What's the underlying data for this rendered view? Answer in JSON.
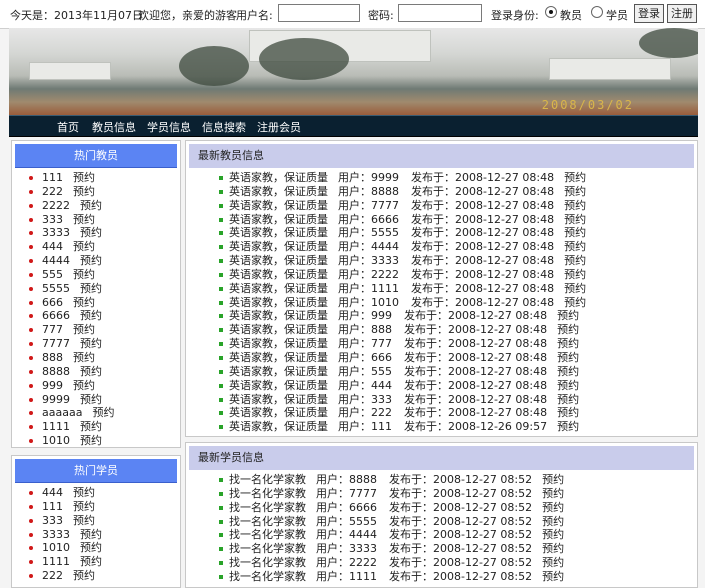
{
  "topbar": {
    "date_text": "今天是：2013年11月07日",
    "welcome": "欢迎您，亲爱的游客",
    "username_label": "用户名:",
    "username_value": "",
    "password_label": "密码:",
    "password_value": "",
    "role_label": "登录身份:",
    "role_teacher": "教员",
    "role_student": "学员",
    "role_selected": "教员",
    "login_button": "登录",
    "register_button": "注册"
  },
  "banner": {
    "date_overlay": "2008/03/02"
  },
  "nav": [
    "首页",
    "教员信息",
    "学员信息",
    "信息搜索",
    "注册会员"
  ],
  "hot_teachers": {
    "title": "热门教员",
    "book_label": "预约",
    "items": [
      "111",
      "222",
      "2222",
      "333",
      "3333",
      "444",
      "4444",
      "555",
      "5555",
      "666",
      "6666",
      "777",
      "7777",
      "888",
      "8888",
      "999",
      "9999",
      "aaaaaa",
      "1111",
      "1010"
    ]
  },
  "hot_students": {
    "title": "热门学员",
    "book_label": "预约",
    "items": [
      "444",
      "111",
      "333",
      "3333",
      "1010",
      "1111",
      "222"
    ]
  },
  "teacher_info": {
    "title": "最新教员信息",
    "user_label": "用户：",
    "published_label": "发布于：",
    "book_label": "预约",
    "rows": [
      {
        "title": "英语家教，保证质量",
        "user": "9999",
        "date": "2008-12-27 08:48"
      },
      {
        "title": "英语家教，保证质量",
        "user": "8888",
        "date": "2008-12-27 08:48"
      },
      {
        "title": "英语家教，保证质量",
        "user": "7777",
        "date": "2008-12-27 08:48"
      },
      {
        "title": "英语家教，保证质量",
        "user": "6666",
        "date": "2008-12-27 08:48"
      },
      {
        "title": "英语家教，保证质量",
        "user": "5555",
        "date": "2008-12-27 08:48"
      },
      {
        "title": "英语家教，保证质量",
        "user": "4444",
        "date": "2008-12-27 08:48"
      },
      {
        "title": "英语家教，保证质量",
        "user": "3333",
        "date": "2008-12-27 08:48"
      },
      {
        "title": "英语家教，保证质量",
        "user": "2222",
        "date": "2008-12-27 08:48"
      },
      {
        "title": "英语家教，保证质量",
        "user": "1111",
        "date": "2008-12-27 08:48"
      },
      {
        "title": "英语家教，保证质量",
        "user": "1010",
        "date": "2008-12-27 08:48"
      },
      {
        "title": "英语家教，保证质量",
        "user": "999",
        "date": "2008-12-27 08:48"
      },
      {
        "title": "英语家教，保证质量",
        "user": "888",
        "date": "2008-12-27 08:48"
      },
      {
        "title": "英语家教，保证质量",
        "user": "777",
        "date": "2008-12-27 08:48"
      },
      {
        "title": "英语家教，保证质量",
        "user": "666",
        "date": "2008-12-27 08:48"
      },
      {
        "title": "英语家教，保证质量",
        "user": "555",
        "date": "2008-12-27 08:48"
      },
      {
        "title": "英语家教，保证质量",
        "user": "444",
        "date": "2008-12-27 08:48"
      },
      {
        "title": "英语家教，保证质量",
        "user": "333",
        "date": "2008-12-27 08:48"
      },
      {
        "title": "英语家教，保证质量",
        "user": "222",
        "date": "2008-12-27 08:48"
      },
      {
        "title": "英语家教，保证质量",
        "user": "111",
        "date": "2008-12-26 09:57"
      }
    ]
  },
  "student_info": {
    "title": "最新学员信息",
    "user_label": "用户：",
    "published_label": "发布于：",
    "book_label": "预约",
    "rows": [
      {
        "title": "找一名化学家教",
        "user": "8888",
        "date": "2008-12-27 08:52"
      },
      {
        "title": "找一名化学家教",
        "user": "7777",
        "date": "2008-12-27 08:52"
      },
      {
        "title": "找一名化学家教",
        "user": "6666",
        "date": "2008-12-27 08:52"
      },
      {
        "title": "找一名化学家教",
        "user": "5555",
        "date": "2008-12-27 08:52"
      },
      {
        "title": "找一名化学家教",
        "user": "4444",
        "date": "2008-12-27 08:52"
      },
      {
        "title": "找一名化学家教",
        "user": "3333",
        "date": "2008-12-27 08:52"
      },
      {
        "title": "找一名化学家教",
        "user": "2222",
        "date": "2008-12-27 08:52"
      },
      {
        "title": "找一名化学家教",
        "user": "1111",
        "date": "2008-12-27 08:52"
      }
    ]
  },
  "colors": {
    "nav_bg": "#0a2030",
    "hot_header": "#5b84f3",
    "info_header": "#c9cceb",
    "bullet_red": "#d01818",
    "bullet_green": "#29a329"
  }
}
